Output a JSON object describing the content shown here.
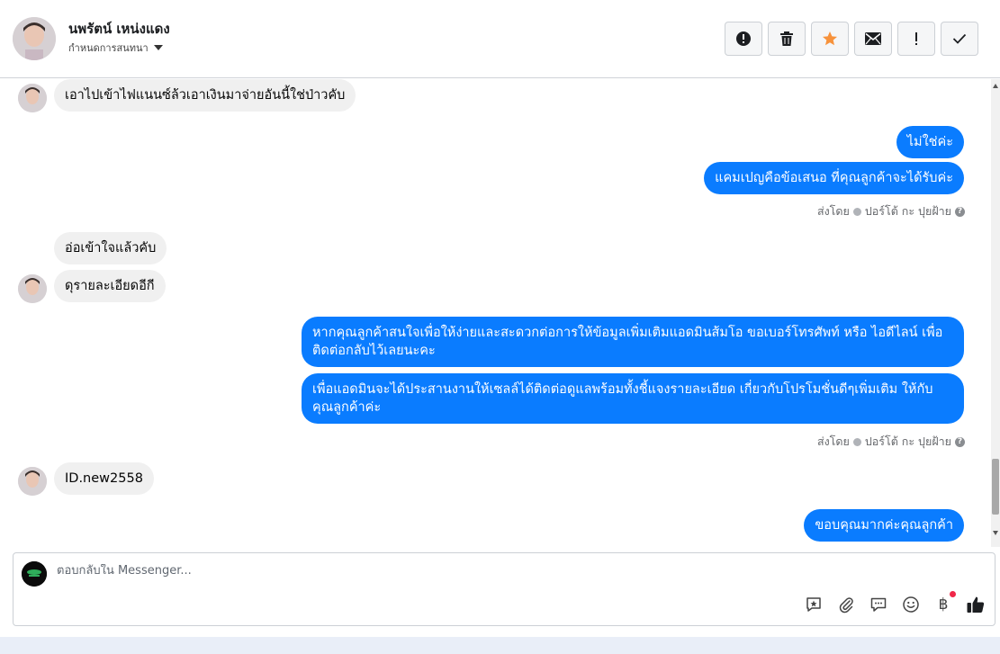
{
  "header": {
    "contact_name": "นพรัตน์ เหน่งแดง",
    "assign_label": "กำหนดการสนทนา",
    "actions": [
      {
        "name": "spam-button",
        "icon": "alert-circle-icon"
      },
      {
        "name": "delete-button",
        "icon": "trash-icon"
      },
      {
        "name": "star-button",
        "icon": "star-icon",
        "color": "#f7923b"
      },
      {
        "name": "mark-unread-button",
        "icon": "envelope-icon"
      },
      {
        "name": "follow-up-button",
        "icon": "exclamation-icon"
      },
      {
        "name": "mark-done-button",
        "icon": "checkmark-icon"
      }
    ]
  },
  "messages": {
    "m1": "เอาไปเข้าไฟแนนซ์ล้วเอาเงินมาจ่ายอันนี้ใช่ป่าวคับ",
    "m2": "ไม่ใช่ค่ะ",
    "m3": "แคมเปญคือข้อเสนอ ที่คุณลูกค้าจะได้รับค่ะ",
    "sent_by_1": "ส่งโดย",
    "sender_1": "ปอร์โต้ กะ ปุยฝ้าย",
    "m4": "อ่อเข้าใจแล้วคับ",
    "m5": "ดุรายละเอียดอีกี",
    "m6": "หากคุณลูกค้าสนใจเพื่อให้ง่ายและสะดวกต่อการให้ข้อมูลเพิ่มเติมแอดมินส้มโอ ขอเบอร์โทรศัพท์ หรือ ไอดีไลน์ เพื่อติดต่อกลับไว้เลยนะคะ",
    "m7": "เพื่อแอดมินจะได้ประสานงานให้เซลล์ได้ติดต่อดูแลพร้อมทั้งชี้แจงรายละเอียด เกี่ยวกับโปรโมชั่นดีๆเพิ่มเติม ให้กับคุณลูกค้าค่ะ",
    "sent_by_2": "ส่งโดย",
    "sender_2": "ปอร์โต้ กะ ปุยฝ้าย",
    "m8": "ID.new2558",
    "m9": "ขอบคุณมากค่ะคุณลูกค้า"
  },
  "composer": {
    "placeholder": "ตอบกลับใน Messenger...",
    "tools": [
      "saved-reply-icon",
      "attachment-icon",
      "chat-bubble-icon",
      "emoji-icon",
      "baht-icon",
      "thumbs-up-icon"
    ],
    "baht_symbol": "฿",
    "like_color": "#1c1e21"
  },
  "colors": {
    "outgoing_bubble": "#0a7cff",
    "incoming_bubble": "#f0f0f0",
    "star": "#f7923b",
    "notification_dot": "#f02849"
  }
}
